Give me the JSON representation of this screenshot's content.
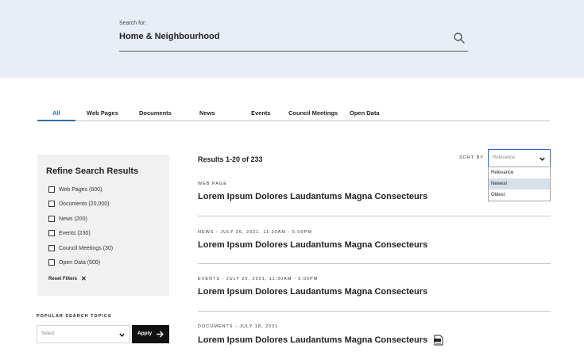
{
  "search": {
    "label": "Search for:",
    "value": "Home & Neighbourhood",
    "icon": "search-icon"
  },
  "tabs": [
    {
      "label": "All",
      "active": true
    },
    {
      "label": "Web Pages"
    },
    {
      "label": "Documents"
    },
    {
      "label": "News"
    },
    {
      "label": "Events"
    },
    {
      "label": "Council Meetings"
    },
    {
      "label": "Open Data"
    }
  ],
  "filters": {
    "title": "Refine Search Results",
    "items": [
      {
        "label": "Web Pages (600)"
      },
      {
        "label": "Documents (20,000)"
      },
      {
        "label": "News (200)"
      },
      {
        "label": "Events (230)"
      },
      {
        "label": "Council Meetings (30)"
      },
      {
        "label": "Open Data (500)"
      }
    ],
    "reset_label": "Reset Filters",
    "reset_icon": "close-icon"
  },
  "popular": {
    "title": "POPULAR SEARCH TOPICS",
    "select_placeholder": "Select",
    "apply_label": "Apply"
  },
  "results": {
    "count_text": "Results 1-20 of 233",
    "sort_label": "SORT BY",
    "sort_selected": "Relevance",
    "sort_options": [
      "Relevance",
      "Newest",
      "Oldest"
    ],
    "sort_highlighted": "Newest",
    "items": [
      {
        "meta": "WEB PAGE",
        "title": "Lorem Ipsum Dolores Laudantums Magna Consecteurs"
      },
      {
        "meta": "NEWS - JULY 26, 2021, 11:30AM - 5:00PM",
        "title": "Lorem Ipsum Dolores Laudantums Magna Consecteurs"
      },
      {
        "meta": "EVENTS - JULY 26, 2021, 11:30AM - 5:00PM",
        "title": "Lorem Ipsum Dolores Laudantums Magna Consecteurs"
      },
      {
        "meta": "DOCUMENTS - JULY 18, 2021",
        "title": "Lorem Ipsum Dolores Laudantums Magna Consecteurs",
        "icon": "document-icon"
      }
    ]
  },
  "colors": {
    "hero_bg": "#e8eef5",
    "accent": "#2f6fb4",
    "panel_bg": "#f1f1f1",
    "button_bg": "#111111"
  }
}
